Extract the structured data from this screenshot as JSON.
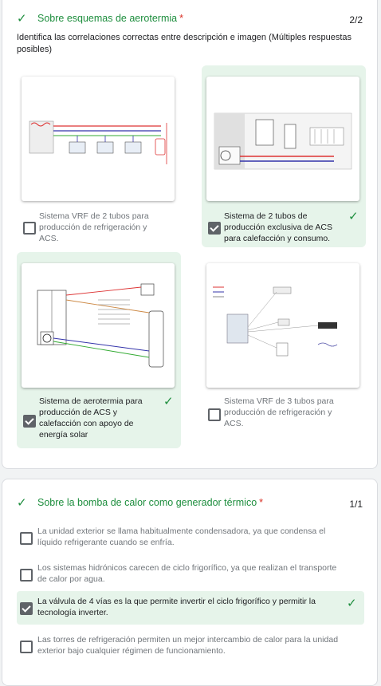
{
  "q1": {
    "title": "Sobre esquemas de aerotermia",
    "required_mark": "*",
    "score": "2/2",
    "description": "Identifica las correlaciones correctas entre descripción e imagen (Múltiples respuestas posibles)",
    "options": [
      {
        "label": "Sistema VRF de 2 tubos para producción de refrigeración y ACS.",
        "checked": false,
        "correct": false
      },
      {
        "label": "Sistema de 2 tubos de producción exclusiva de ACS para calefacción y consumo.",
        "checked": true,
        "correct": true
      },
      {
        "label": "Sistema de aerotermia para producción de ACS y calefacción con apoyo de energía solar",
        "checked": true,
        "correct": true
      },
      {
        "label": "Sistema VRF de 3 tubos para producción de refrigeración y ACS.",
        "checked": false,
        "correct": false
      }
    ]
  },
  "q2": {
    "title": "Sobre la bomba de calor como generador térmico",
    "required_mark": "*",
    "score": "1/1",
    "options": [
      {
        "label": "La unidad exterior se llama habitualmente condensadora, ya que condensa el líquido refrigerante cuando se enfría.",
        "checked": false,
        "correct": false
      },
      {
        "label": "Los sistemas hidrónicos carecen de ciclo frigorífico, ya que realizan el transporte de calor por agua.",
        "checked": false,
        "correct": false
      },
      {
        "label": "La válvula de 4 vías es la que permite invertir el ciclo frigorífico y permitir la tecnología inverter.",
        "checked": true,
        "correct": true
      },
      {
        "label": "Las torres de refrigeración permiten un mejor intercambio de calor para la unidad exterior bajo cualquier régimen de funcionamiento.",
        "checked": false,
        "correct": false
      }
    ]
  },
  "icons": {
    "check": "check-icon"
  },
  "colors": {
    "correct_bg": "#e6f4ea",
    "correct_green": "#1e8e3e",
    "required_red": "#d93025"
  }
}
